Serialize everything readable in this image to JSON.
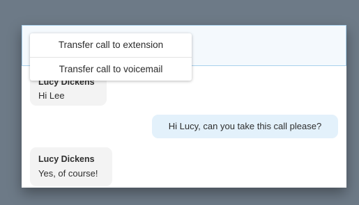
{
  "transfer_menu": {
    "items": [
      {
        "label": "Transfer call to extension"
      },
      {
        "label": "Transfer call to voicemail"
      }
    ]
  },
  "chat": {
    "messages": [
      {
        "sender": "Lucy Dickens",
        "text": "Hi Lee",
        "direction": "incoming"
      },
      {
        "sender": "",
        "text": "Hi Lucy, can you take this call please?",
        "direction": "outgoing"
      },
      {
        "sender": "Lucy Dickens",
        "text": "Yes, of course!",
        "direction": "incoming"
      }
    ]
  },
  "colors": {
    "background": "#6d7a87",
    "header_border": "#a8d0ec",
    "outgoing_bubble": "#e3f1fb",
    "incoming_bubble": "#f3f3f3"
  }
}
